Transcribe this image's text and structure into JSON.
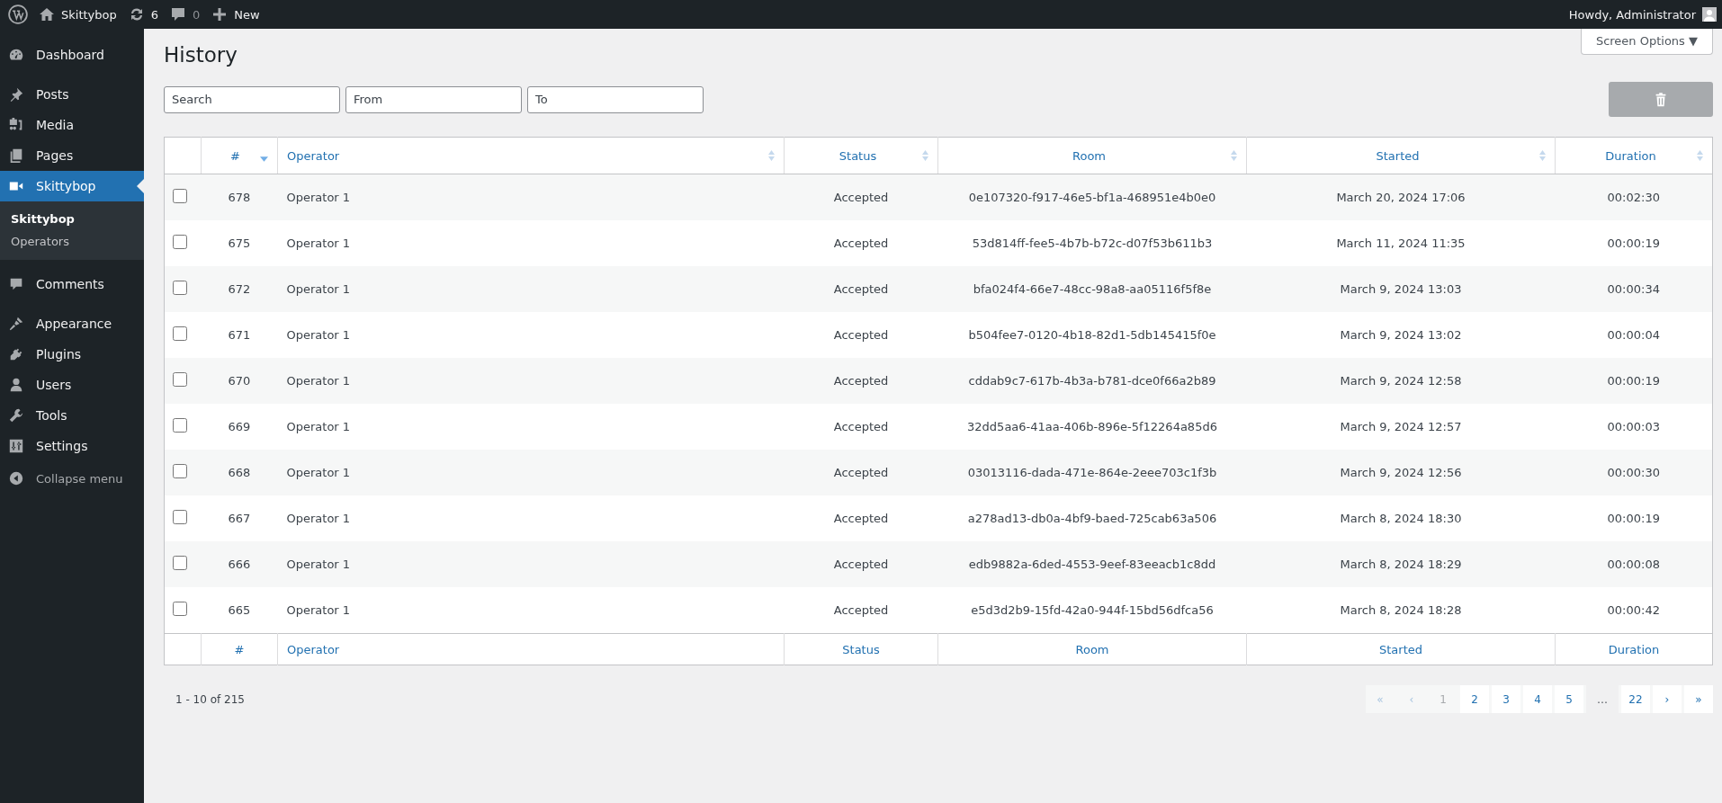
{
  "admin_bar": {
    "site_name": "Skittybop",
    "updates": "6",
    "comments": "0",
    "new": "New",
    "greeting": "Howdy, Administrator"
  },
  "sidebar": {
    "items": [
      {
        "label": "Dashboard",
        "selected": false
      },
      {
        "label": "Posts",
        "selected": false
      },
      {
        "label": "Media",
        "selected": false
      },
      {
        "label": "Pages",
        "selected": false
      },
      {
        "label": "Skittybop",
        "selected": true,
        "submenu": [
          {
            "label": "Skittybop",
            "selected": true
          },
          {
            "label": "Operators",
            "selected": false
          }
        ]
      },
      {
        "label": "Comments",
        "selected": false
      },
      {
        "label": "Appearance",
        "selected": false
      },
      {
        "label": "Plugins",
        "selected": false
      },
      {
        "label": "Users",
        "selected": false
      },
      {
        "label": "Tools",
        "selected": false
      },
      {
        "label": "Settings",
        "selected": false
      }
    ],
    "collapse": "Collapse menu"
  },
  "screen_options": "Screen Options ▼",
  "page_title": "History",
  "filters": [
    {
      "placeholder": "Search"
    },
    {
      "placeholder": "From"
    },
    {
      "placeholder": "To"
    }
  ],
  "delete_button": {
    "disabled": true
  },
  "table": {
    "columns": [
      {
        "label": "#",
        "sorted": true
      },
      {
        "label": "Operator",
        "sorted": false
      },
      {
        "label": "Status",
        "sorted": false
      },
      {
        "label": "Room",
        "sorted": false
      },
      {
        "label": "Started",
        "sorted": false
      },
      {
        "label": "Duration",
        "sorted": false
      }
    ],
    "rows": [
      {
        "checked": false,
        "cells": [
          "678",
          "Operator 1",
          "Accepted",
          "0e107320-f917-46e5-bf1a-468951e4b0e0",
          "March 20, 2024 17:06",
          "00:02:30"
        ]
      },
      {
        "checked": false,
        "cells": [
          "675",
          "Operator 1",
          "Accepted",
          "53d814ff-fee5-4b7b-b72c-d07f53b611b3",
          "March 11, 2024 11:35",
          "00:00:19"
        ]
      },
      {
        "checked": false,
        "cells": [
          "672",
          "Operator 1",
          "Accepted",
          "bfa024f4-66e7-48cc-98a8-aa05116f5f8e",
          "March 9, 2024 13:03",
          "00:00:34"
        ]
      },
      {
        "checked": false,
        "cells": [
          "671",
          "Operator 1",
          "Accepted",
          "b504fee7-0120-4b18-82d1-5db145415f0e",
          "March 9, 2024 13:02",
          "00:00:04"
        ]
      },
      {
        "checked": false,
        "cells": [
          "670",
          "Operator 1",
          "Accepted",
          "cddab9c7-617b-4b3a-b781-dce0f66a2b89",
          "March 9, 2024 12:58",
          "00:00:19"
        ]
      },
      {
        "checked": false,
        "cells": [
          "669",
          "Operator 1",
          "Accepted",
          "32dd5aa6-41aa-406b-896e-5f12264a85d6",
          "March 9, 2024 12:57",
          "00:00:03"
        ]
      },
      {
        "checked": false,
        "cells": [
          "668",
          "Operator 1",
          "Accepted",
          "03013116-dada-471e-864e-2eee703c1f3b",
          "March 9, 2024 12:56",
          "00:00:30"
        ]
      },
      {
        "checked": false,
        "cells": [
          "667",
          "Operator 1",
          "Accepted",
          "a278ad13-db0a-4bf9-baed-725cab63a506",
          "March 8, 2024 18:30",
          "00:00:19"
        ]
      },
      {
        "checked": false,
        "cells": [
          "666",
          "Operator 1",
          "Accepted",
          "edb9882a-6ded-4553-9eef-83eeacb1c8dd",
          "March 8, 2024 18:29",
          "00:00:08"
        ]
      },
      {
        "checked": false,
        "cells": [
          "665",
          "Operator 1",
          "Accepted",
          "e5d3d2b9-15fd-42a0-944f-15bd56dfca56",
          "March 8, 2024 18:28",
          "00:00:42"
        ]
      }
    ],
    "footer_columns": [
      "#",
      "Operator",
      "Status",
      "Room",
      "Started",
      "Duration"
    ]
  },
  "summary": "1 - 10 of 215",
  "pagination": [
    {
      "kind": "page",
      "label": "«",
      "disabled": true,
      "selected": false
    },
    {
      "kind": "page",
      "label": "‹",
      "disabled": true,
      "selected": false
    },
    {
      "kind": "page",
      "label": "1",
      "disabled": false,
      "selected": true
    },
    {
      "kind": "page",
      "label": "2",
      "disabled": false,
      "selected": false
    },
    {
      "kind": "page",
      "label": "3",
      "disabled": false,
      "selected": false
    },
    {
      "kind": "page",
      "label": "4",
      "disabled": false,
      "selected": false
    },
    {
      "kind": "page",
      "label": "5",
      "disabled": false,
      "selected": false
    },
    {
      "kind": "gap",
      "label": "…"
    },
    {
      "kind": "page",
      "label": "22",
      "disabled": false,
      "selected": false
    },
    {
      "kind": "page",
      "label": "›",
      "disabled": false,
      "selected": false
    },
    {
      "kind": "page",
      "label": "»",
      "disabled": false,
      "selected": false
    }
  ]
}
